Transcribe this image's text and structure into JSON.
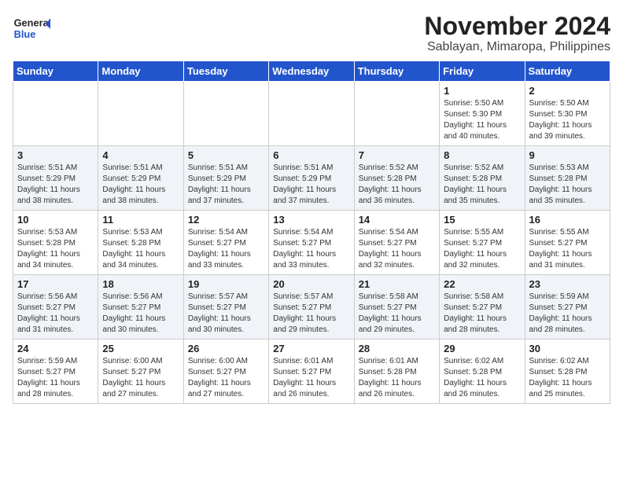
{
  "header": {
    "logo_general": "General",
    "logo_blue": "Blue",
    "month_title": "November 2024",
    "location": "Sablayan, Mimaropa, Philippines"
  },
  "weekdays": [
    "Sunday",
    "Monday",
    "Tuesday",
    "Wednesday",
    "Thursday",
    "Friday",
    "Saturday"
  ],
  "weeks": [
    [
      {
        "day": "",
        "info": ""
      },
      {
        "day": "",
        "info": ""
      },
      {
        "day": "",
        "info": ""
      },
      {
        "day": "",
        "info": ""
      },
      {
        "day": "",
        "info": ""
      },
      {
        "day": "1",
        "info": "Sunrise: 5:50 AM\nSunset: 5:30 PM\nDaylight: 11 hours\nand 40 minutes."
      },
      {
        "day": "2",
        "info": "Sunrise: 5:50 AM\nSunset: 5:30 PM\nDaylight: 11 hours\nand 39 minutes."
      }
    ],
    [
      {
        "day": "3",
        "info": "Sunrise: 5:51 AM\nSunset: 5:29 PM\nDaylight: 11 hours\nand 38 minutes."
      },
      {
        "day": "4",
        "info": "Sunrise: 5:51 AM\nSunset: 5:29 PM\nDaylight: 11 hours\nand 38 minutes."
      },
      {
        "day": "5",
        "info": "Sunrise: 5:51 AM\nSunset: 5:29 PM\nDaylight: 11 hours\nand 37 minutes."
      },
      {
        "day": "6",
        "info": "Sunrise: 5:51 AM\nSunset: 5:29 PM\nDaylight: 11 hours\nand 37 minutes."
      },
      {
        "day": "7",
        "info": "Sunrise: 5:52 AM\nSunset: 5:28 PM\nDaylight: 11 hours\nand 36 minutes."
      },
      {
        "day": "8",
        "info": "Sunrise: 5:52 AM\nSunset: 5:28 PM\nDaylight: 11 hours\nand 35 minutes."
      },
      {
        "day": "9",
        "info": "Sunrise: 5:53 AM\nSunset: 5:28 PM\nDaylight: 11 hours\nand 35 minutes."
      }
    ],
    [
      {
        "day": "10",
        "info": "Sunrise: 5:53 AM\nSunset: 5:28 PM\nDaylight: 11 hours\nand 34 minutes."
      },
      {
        "day": "11",
        "info": "Sunrise: 5:53 AM\nSunset: 5:28 PM\nDaylight: 11 hours\nand 34 minutes."
      },
      {
        "day": "12",
        "info": "Sunrise: 5:54 AM\nSunset: 5:27 PM\nDaylight: 11 hours\nand 33 minutes."
      },
      {
        "day": "13",
        "info": "Sunrise: 5:54 AM\nSunset: 5:27 PM\nDaylight: 11 hours\nand 33 minutes."
      },
      {
        "day": "14",
        "info": "Sunrise: 5:54 AM\nSunset: 5:27 PM\nDaylight: 11 hours\nand 32 minutes."
      },
      {
        "day": "15",
        "info": "Sunrise: 5:55 AM\nSunset: 5:27 PM\nDaylight: 11 hours\nand 32 minutes."
      },
      {
        "day": "16",
        "info": "Sunrise: 5:55 AM\nSunset: 5:27 PM\nDaylight: 11 hours\nand 31 minutes."
      }
    ],
    [
      {
        "day": "17",
        "info": "Sunrise: 5:56 AM\nSunset: 5:27 PM\nDaylight: 11 hours\nand 31 minutes."
      },
      {
        "day": "18",
        "info": "Sunrise: 5:56 AM\nSunset: 5:27 PM\nDaylight: 11 hours\nand 30 minutes."
      },
      {
        "day": "19",
        "info": "Sunrise: 5:57 AM\nSunset: 5:27 PM\nDaylight: 11 hours\nand 30 minutes."
      },
      {
        "day": "20",
        "info": "Sunrise: 5:57 AM\nSunset: 5:27 PM\nDaylight: 11 hours\nand 29 minutes."
      },
      {
        "day": "21",
        "info": "Sunrise: 5:58 AM\nSunset: 5:27 PM\nDaylight: 11 hours\nand 29 minutes."
      },
      {
        "day": "22",
        "info": "Sunrise: 5:58 AM\nSunset: 5:27 PM\nDaylight: 11 hours\nand 28 minutes."
      },
      {
        "day": "23",
        "info": "Sunrise: 5:59 AM\nSunset: 5:27 PM\nDaylight: 11 hours\nand 28 minutes."
      }
    ],
    [
      {
        "day": "24",
        "info": "Sunrise: 5:59 AM\nSunset: 5:27 PM\nDaylight: 11 hours\nand 28 minutes."
      },
      {
        "day": "25",
        "info": "Sunrise: 6:00 AM\nSunset: 5:27 PM\nDaylight: 11 hours\nand 27 minutes."
      },
      {
        "day": "26",
        "info": "Sunrise: 6:00 AM\nSunset: 5:27 PM\nDaylight: 11 hours\nand 27 minutes."
      },
      {
        "day": "27",
        "info": "Sunrise: 6:01 AM\nSunset: 5:27 PM\nDaylight: 11 hours\nand 26 minutes."
      },
      {
        "day": "28",
        "info": "Sunrise: 6:01 AM\nSunset: 5:28 PM\nDaylight: 11 hours\nand 26 minutes."
      },
      {
        "day": "29",
        "info": "Sunrise: 6:02 AM\nSunset: 5:28 PM\nDaylight: 11 hours\nand 26 minutes."
      },
      {
        "day": "30",
        "info": "Sunrise: 6:02 AM\nSunset: 5:28 PM\nDaylight: 11 hours\nand 25 minutes."
      }
    ]
  ]
}
